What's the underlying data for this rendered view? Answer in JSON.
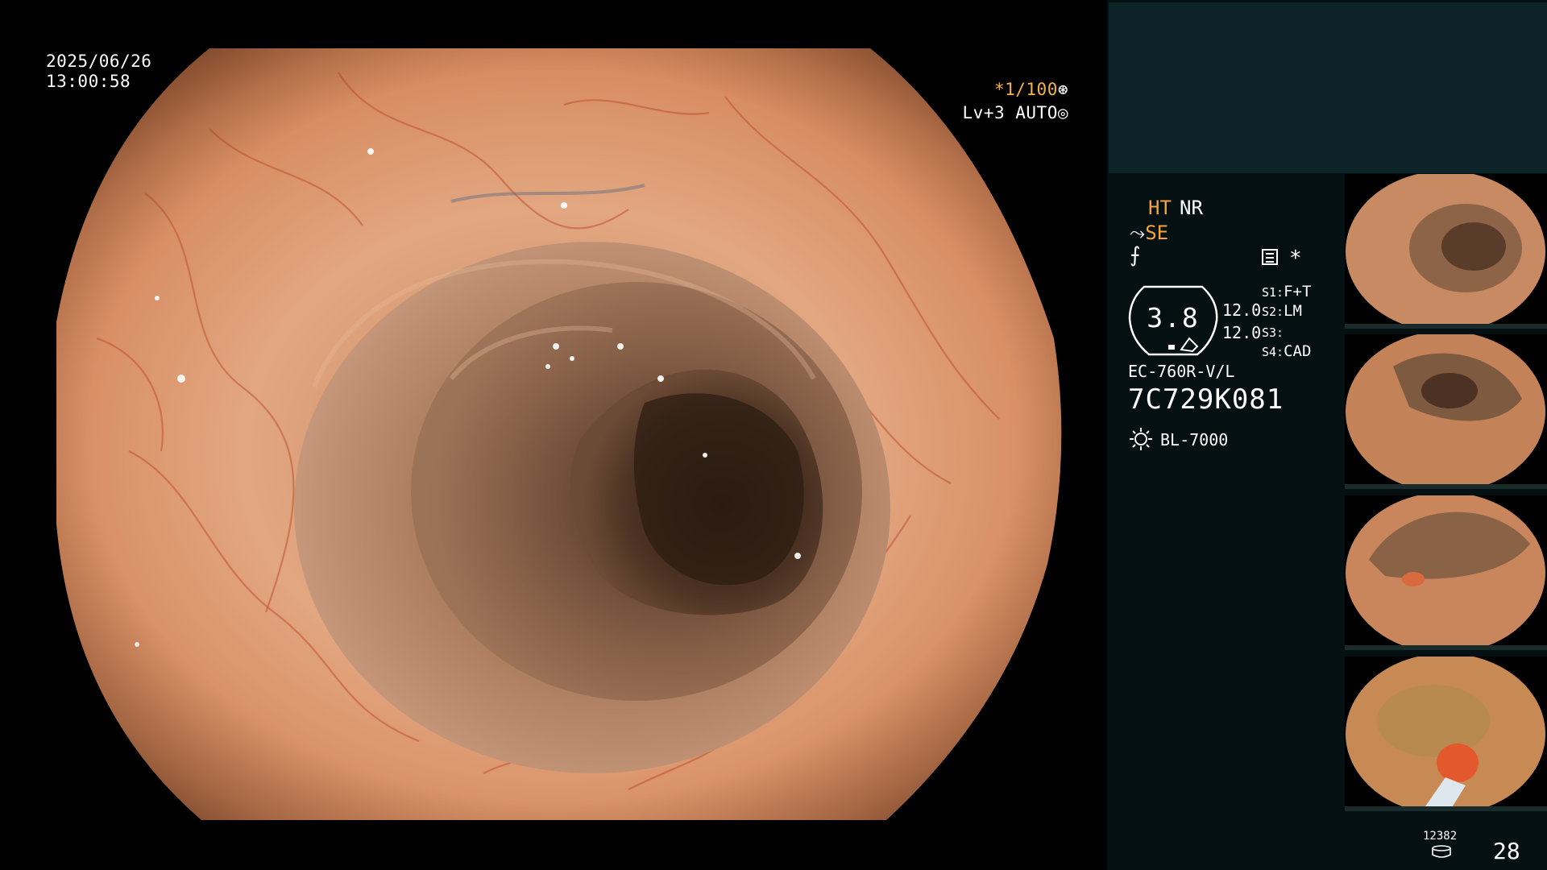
{
  "overlay": {
    "date": "2025/06/26",
    "time": "13:00:58",
    "shutter_speed": "*1/100",
    "shutter_icon": "aperture-icon",
    "level": "Lv+3",
    "iris_mode": "AUTO",
    "iris_icon": "target-icon"
  },
  "settings": {
    "ht": "HT",
    "nr": "NR",
    "se": "SE",
    "se_icon": "hand-lever-icon",
    "f_icon": "freeze-icon",
    "star": "*",
    "exposure_value": "3.8",
    "value_a": "12.0",
    "value_b": "12.0",
    "switches": [
      {
        "key": "S1:",
        "value": "F+T"
      },
      {
        "key": "S2:",
        "value": "LM"
      },
      {
        "key": "S3:",
        "value": ""
      },
      {
        "key": "S4:",
        "value": "CAD"
      }
    ]
  },
  "device": {
    "scope_model": "EC-760R-V/L",
    "scope_serial": "7C729K081",
    "light_source": "BL-7000",
    "light_icon": "sun-icon"
  },
  "thumbnails": [
    {
      "index": 1,
      "label": "captured-frame-1"
    },
    {
      "index": 2,
      "label": "captured-frame-2"
    },
    {
      "index": 3,
      "label": "captured-frame-3"
    },
    {
      "index": 4,
      "label": "captured-frame-4"
    }
  ],
  "footer": {
    "image_count": "12382",
    "disk_icon": "storage-icon",
    "frame_number": "28"
  },
  "colors": {
    "panel_bg": "#041011",
    "panel_top": "#0c2427",
    "accent_orange": "#f5a33a",
    "mucosa": "#d98a5e"
  }
}
